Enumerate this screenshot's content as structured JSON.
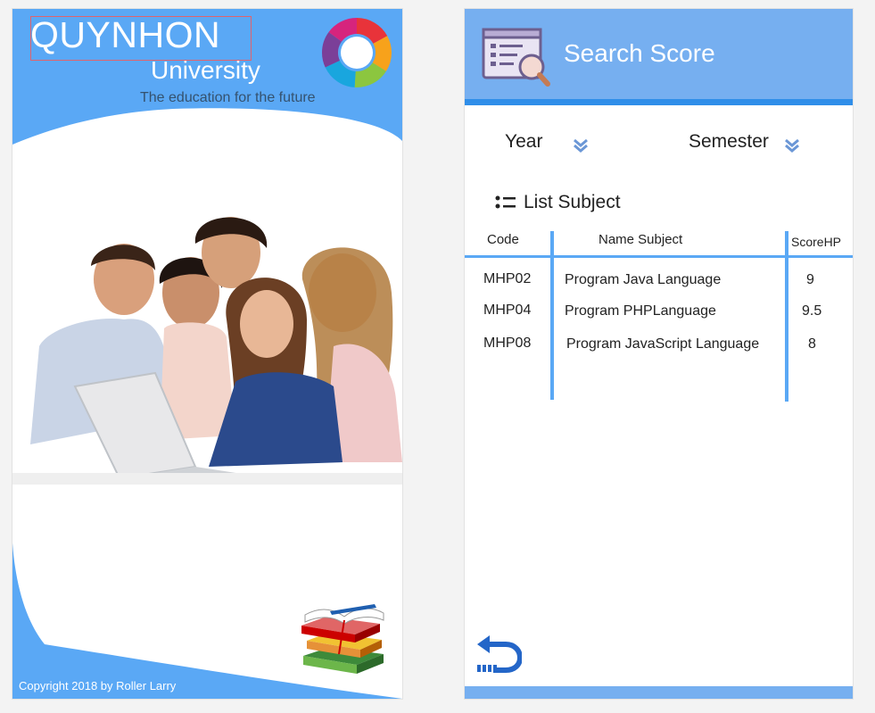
{
  "left_screen": {
    "brand_name": "QUYNHON",
    "brand_subtitle": "University",
    "tagline": "The education for the future",
    "copyright": "Copyright 2018 by Roller Larry",
    "colors": {
      "primary": "#5aa8f5",
      "text_on_primary": "#ffffff",
      "tagline": "#35526f"
    }
  },
  "right_screen": {
    "header": {
      "title": "Search Score",
      "icon": "search-document-icon"
    },
    "filters": {
      "year_label": "Year",
      "semester_label": "Semester",
      "dropdown_icon": "double-chevron-down-icon"
    },
    "list": {
      "title": "List Subject",
      "icon": "list-icon",
      "columns": [
        "Code",
        "Name Subject",
        "ScoreHP"
      ],
      "rows": [
        {
          "code": "MHP02",
          "name": "Program Java Language",
          "score": "9"
        },
        {
          "code": "MHP04",
          "name": "Program PHPLanguage",
          "score": "9.5"
        },
        {
          "code": "MHP08",
          "name": "Program JavaScript Language",
          "score": "8"
        }
      ]
    },
    "back_icon": "back-arrow-icon",
    "colors": {
      "header": "#76aff0",
      "accent": "#2f8ee9",
      "divider": "#5aa8f5"
    }
  }
}
